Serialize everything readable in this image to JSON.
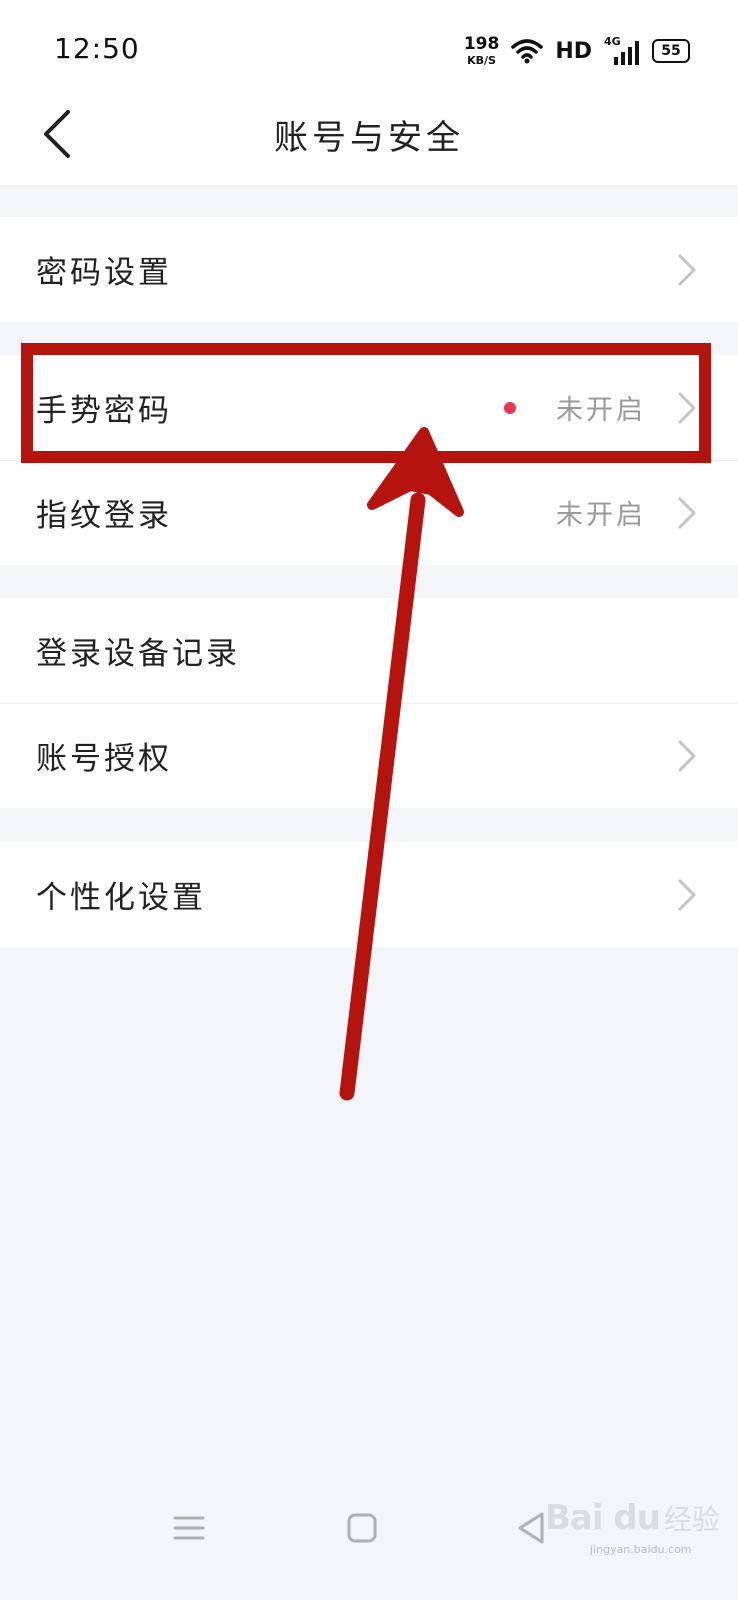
{
  "status_bar": {
    "time": "12:50",
    "net_speed": "198",
    "net_speed_unit": "KB/S",
    "hd_label": "HD",
    "network_type": "4G",
    "battery": "55"
  },
  "header": {
    "title": "账号与安全"
  },
  "menu": {
    "password_settings": {
      "label": "密码设置"
    },
    "gesture_password": {
      "label": "手势密码",
      "value": "未开启"
    },
    "fingerprint_login": {
      "label": "指纹登录",
      "value": "未开启"
    },
    "login_device_records": {
      "label": "登录设备记录"
    },
    "account_authorization": {
      "label": "账号授权"
    },
    "personalization": {
      "label": "个性化设置"
    }
  },
  "watermark": {
    "brand": "Bai du",
    "brand_cn": "经验",
    "url": "jingyan.baidu.com"
  },
  "colors": {
    "accent_dot": "#e8384f",
    "annotation_red": "#b5140e",
    "secondary_text": "#9a9a9a",
    "page_background": "#f4f5f9"
  },
  "icons": [
    "back-arrow-icon",
    "chevron-right-icon",
    "wifi-icon",
    "signal-icon",
    "battery-icon",
    "menu-icon",
    "home-icon",
    "back-triangle-icon"
  ]
}
